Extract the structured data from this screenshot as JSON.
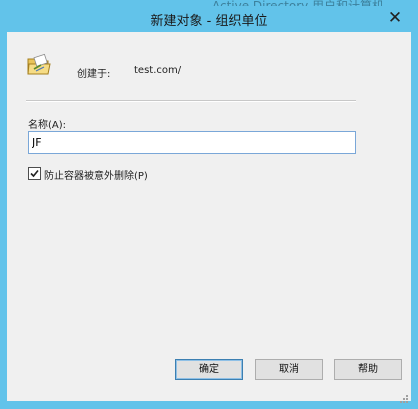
{
  "background": {
    "fragment": "Active Directory 用户和计算机"
  },
  "window": {
    "title": "新建对象 - 组织单位",
    "close_glyph": "✕"
  },
  "info": {
    "created_in_label": "创建于:",
    "created_in_value": "test.com/"
  },
  "form": {
    "name_label": "名称(A):",
    "name_value": "JF",
    "protect_label": "防止容器被意外删除(P)",
    "protect_checked": true
  },
  "buttons": {
    "ok": "确定",
    "cancel": "取消",
    "help": "帮助"
  },
  "colors": {
    "frame": "#62c3ea",
    "client": "#f0f0f0",
    "input_border": "#7aa7d8"
  }
}
